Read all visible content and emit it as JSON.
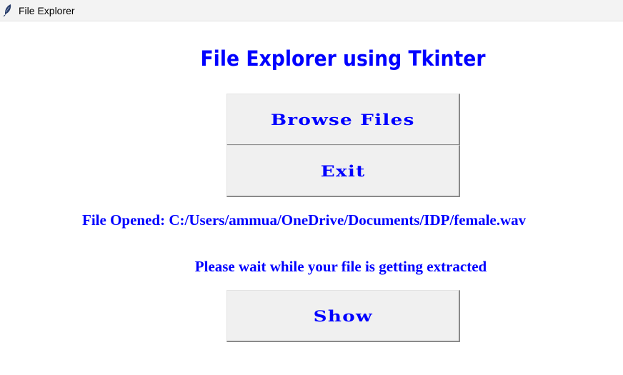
{
  "window": {
    "title": "File Explorer",
    "icon": "feather-icon"
  },
  "heading": "File Explorer using Tkinter",
  "buttons": {
    "browse": "Browse Files",
    "exit": "Exit",
    "show": "Show"
  },
  "file_opened_label": "File Opened: C:/Users/ammua/OneDrive/Documents/IDP/female.wav",
  "wait_message": "Please wait while your file is getting extracted",
  "colors": {
    "text_accent": "#0000ff",
    "button_face": "#f0f0f0",
    "titlebar_bg": "#f3f3f3"
  }
}
